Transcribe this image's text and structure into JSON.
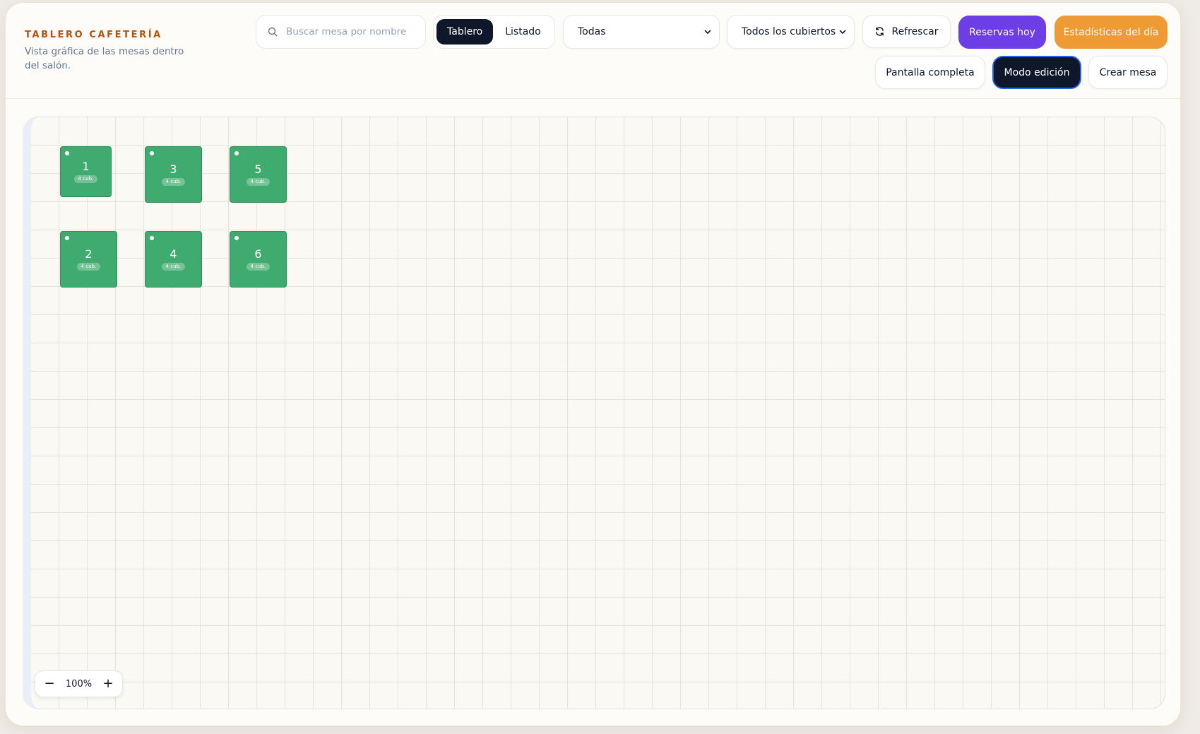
{
  "brand": {
    "title": "TABLERO CAFETERÍA",
    "subtitle": "Vista gráfica de las mesas dentro del salón."
  },
  "search": {
    "placeholder": "Buscar mesa por nombre",
    "value": ""
  },
  "view_toggle": {
    "options": [
      "Tablero",
      "Listado"
    ],
    "active": "Tablero"
  },
  "filters": {
    "status": {
      "selected": "Todas"
    },
    "covers": {
      "selected": "Todos los cubiertos"
    }
  },
  "actions": {
    "refresh": "Refrescar",
    "reservations": "Reservas hoy",
    "stats": "Estadísticas del día",
    "fullscreen": "Pantalla completa",
    "edit_mode": "Modo edición",
    "create_table": "Crear mesa"
  },
  "tables": [
    {
      "number": "1",
      "covers": "4 cub."
    },
    {
      "number": "3",
      "covers": "4 cub."
    },
    {
      "number": "5",
      "covers": "4 cub."
    },
    {
      "number": "2",
      "covers": "4 cub."
    },
    {
      "number": "4",
      "covers": "4 cub."
    },
    {
      "number": "6",
      "covers": "4 cub."
    }
  ],
  "zoom": {
    "minus": "−",
    "level": "100%",
    "plus": "+"
  },
  "colors": {
    "table_available": "#40ab6f",
    "reservations_button": "#6d3ee6",
    "stats_button": "#ef9b35",
    "brand_accent": "#b4530b",
    "dark": "#0f172a"
  }
}
